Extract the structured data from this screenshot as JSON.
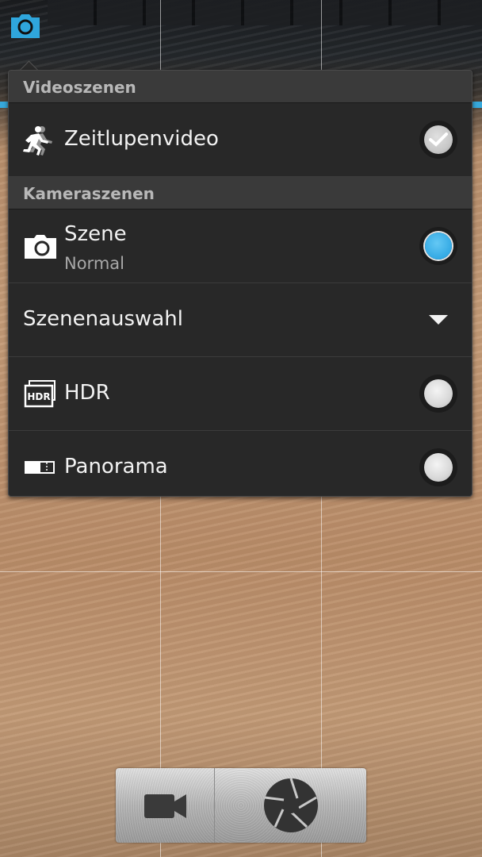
{
  "header": {
    "mode_icon": "camera-mode-icon"
  },
  "popup": {
    "sections": [
      {
        "title": "Videoszenen",
        "items": [
          {
            "label": "Zeitlupenvideo",
            "icon": "running-person-icon",
            "control": "checkbox",
            "checked": false
          }
        ]
      },
      {
        "title": "Kameraszenen",
        "items": [
          {
            "label": "Szene",
            "sublabel": "Normal",
            "icon": "camera-icon",
            "control": "radio",
            "selected": true
          },
          {
            "label": "Szenenauswahl",
            "control": "dropdown"
          },
          {
            "label": "HDR",
            "icon": "hdr-icon",
            "control": "radio",
            "selected": false
          },
          {
            "label": "Panorama",
            "icon": "panorama-icon",
            "control": "radio",
            "selected": false
          }
        ]
      }
    ]
  },
  "controls": {
    "video_button_icon": "video-camera-icon",
    "shutter_button_icon": "aperture-icon"
  },
  "colors": {
    "accent": "#33a9e4",
    "popup_bg": "#282828",
    "section_bg": "#3a3a3a"
  }
}
